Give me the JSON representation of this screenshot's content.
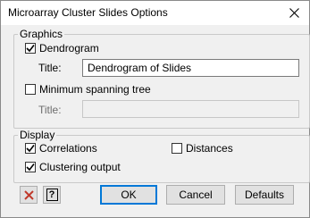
{
  "window": {
    "title": "Microarray Cluster Slides Options"
  },
  "graphics": {
    "legend": "Graphics",
    "dendrogram": {
      "label": "Dendrogram",
      "checked": true
    },
    "title1": {
      "label": "Title:",
      "value": "Dendrogram of Slides"
    },
    "mst": {
      "label": "Minimum spanning tree",
      "checked": false
    },
    "title2": {
      "label": "Title:",
      "value": ""
    }
  },
  "display": {
    "legend": "Display",
    "correlations": {
      "label": "Correlations",
      "checked": true
    },
    "distances": {
      "label": "Distances",
      "checked": false
    },
    "clustering": {
      "label": "Clustering output",
      "checked": true
    }
  },
  "buttons": {
    "ok": "OK",
    "cancel": "Cancel",
    "defaults": "Defaults"
  },
  "icons": {
    "clear": "clear-x-icon",
    "help": "help-icon"
  },
  "colors": {
    "clear_icon": "#c0392b",
    "focus_border": "#0078d7"
  }
}
